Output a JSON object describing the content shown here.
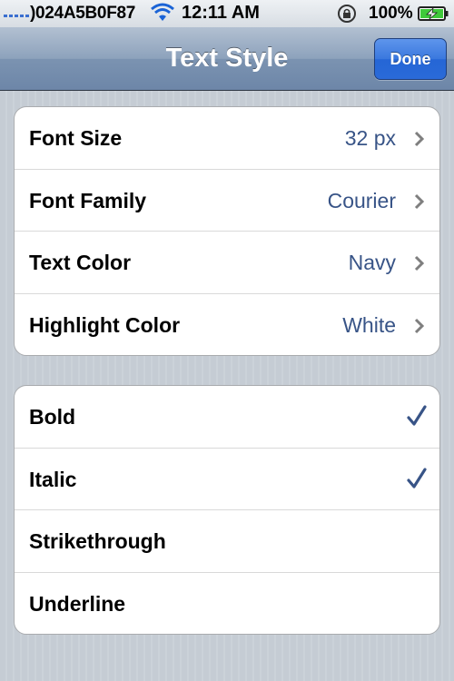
{
  "status_bar": {
    "carrier": ")024A5B0F87",
    "time": "12:11 AM",
    "battery": "100%"
  },
  "nav": {
    "title": "Text Style",
    "done_label": "Done"
  },
  "style_settings": [
    {
      "label": "Font Size",
      "value": "32 px"
    },
    {
      "label": "Font Family",
      "value": "Courier"
    },
    {
      "label": "Text Color",
      "value": "Navy"
    },
    {
      "label": "Highlight Color",
      "value": "White"
    }
  ],
  "style_toggles": [
    {
      "label": "Bold",
      "checked": true
    },
    {
      "label": "Italic",
      "checked": true
    },
    {
      "label": "Strikethrough",
      "checked": false
    },
    {
      "label": "Underline",
      "checked": false
    }
  ],
  "colors": {
    "value_text": "#385487",
    "checkmark": "#385487",
    "done_button": "#2a6ad8"
  },
  "icons": {
    "signal": "signal-bars-icon",
    "wifi": "wifi-icon",
    "rotation_lock": "rotation-lock-icon",
    "battery": "battery-charging-icon",
    "disclosure": "chevron-right-icon",
    "checkmark": "checkmark-icon"
  }
}
